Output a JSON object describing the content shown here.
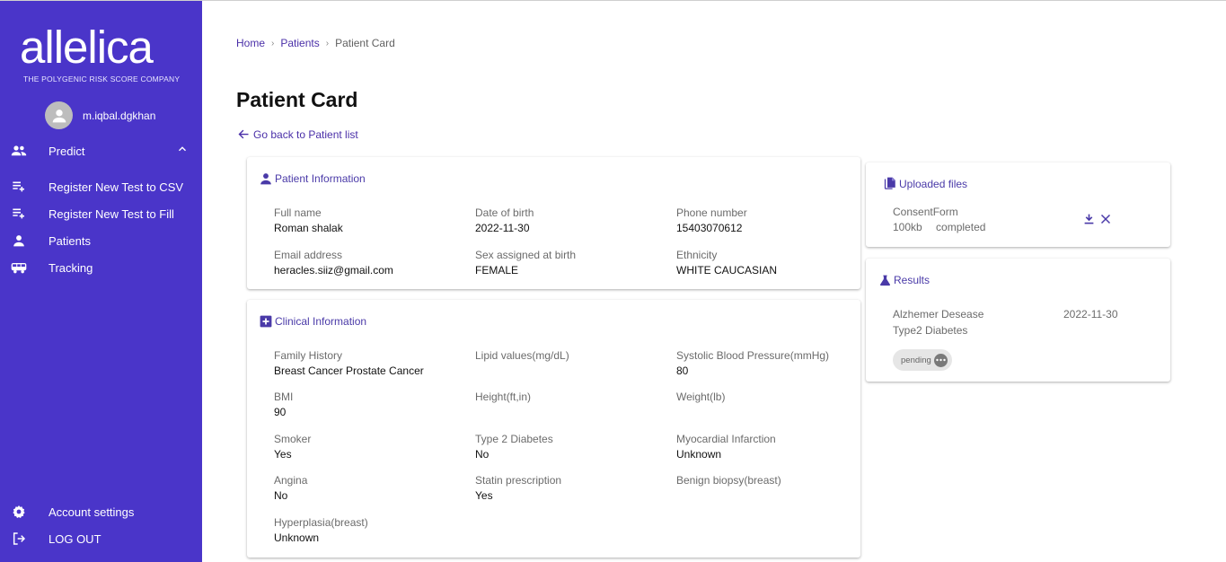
{
  "brand": {
    "name": "allelica",
    "tagline": "THE POLYGENIC RISK SCORE COMPANY"
  },
  "user": {
    "name": "m.iqbal.dgkhan"
  },
  "sidebar": {
    "items": [
      {
        "label": "Predict",
        "icon": "people-icon"
      },
      {
        "label": "Register New Test to CSV",
        "icon": "playlist-add-icon"
      },
      {
        "label": "Register New Test to Fill",
        "icon": "playlist-add-icon"
      },
      {
        "label": "Patients",
        "icon": "person-icon"
      },
      {
        "label": "Tracking",
        "icon": "bus-icon"
      }
    ],
    "bottom": [
      {
        "label": "Account settings",
        "icon": "gear-icon"
      },
      {
        "label": "LOG OUT",
        "icon": "logout-icon"
      }
    ]
  },
  "breadcrumb": {
    "home": "Home",
    "patients": "Patients",
    "current": "Patient Card"
  },
  "page": {
    "title": "Patient Card",
    "back_link": "Go back to Patient list"
  },
  "patient_info": {
    "title": "Patient Information",
    "fields": [
      {
        "label": "Full name",
        "value": "Roman shalak"
      },
      {
        "label": "Date of birth",
        "value": "2022-11-30"
      },
      {
        "label": "Phone number",
        "value": "15403070612"
      },
      {
        "label": "Email address",
        "value": "heracles.siiz@gmail.com"
      },
      {
        "label": "Sex assigned at birth",
        "value": "FEMALE"
      },
      {
        "label": "Ethnicity",
        "value": "WHITE CAUCASIAN"
      }
    ]
  },
  "clinical_info": {
    "title": "Clinical Information",
    "fields": [
      {
        "label": "Family History",
        "value": "Breast Cancer Prostate Cancer"
      },
      {
        "label": "Lipid values(mg/dL)",
        "value": ""
      },
      {
        "label": "Systolic Blood Pressure(mmHg)",
        "value": "80"
      },
      {
        "label": "BMI",
        "value": "90"
      },
      {
        "label": "Height(ft,in)",
        "value": ""
      },
      {
        "label": "Weight(lb)",
        "value": ""
      },
      {
        "label": "Smoker",
        "value": "Yes"
      },
      {
        "label": "Type 2 Diabetes",
        "value": "No"
      },
      {
        "label": "Myocardial Infarction",
        "value": "Unknown"
      },
      {
        "label": "Angina",
        "value": "No"
      },
      {
        "label": "Statin prescription",
        "value": "Yes"
      },
      {
        "label": "Benign biopsy(breast)",
        "value": ""
      },
      {
        "label": "Hyperplasia(breast)",
        "value": "Unknown"
      }
    ]
  },
  "uploaded_files": {
    "title": "Uploaded files",
    "file": {
      "name": "ConsentForm",
      "size": "100kb",
      "status": "completed"
    }
  },
  "results": {
    "title": "Results",
    "rows": [
      {
        "name": "Alzhemer Desease",
        "date": "2022-11-30"
      },
      {
        "name": "Type2 Diabetes",
        "date": ""
      }
    ],
    "status_chip": "pending"
  },
  "colors": {
    "sidebar": "#4a35c9",
    "accent": "#4a2fa8",
    "chip_bg": "#e6e6e6"
  }
}
